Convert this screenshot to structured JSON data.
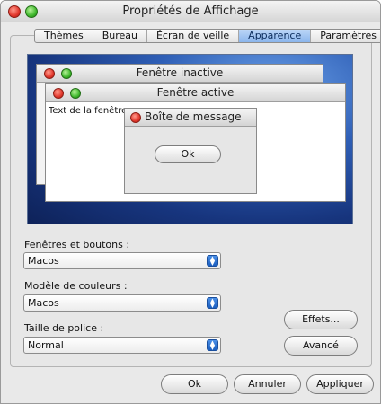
{
  "window": {
    "title": "Propriétés de Affichage"
  },
  "tabs": [
    {
      "label": "Thèmes"
    },
    {
      "label": "Bureau"
    },
    {
      "label": "Écran de veille"
    },
    {
      "label": "Apparence"
    },
    {
      "label": "Paramètres"
    }
  ],
  "active_tab": "Apparence",
  "preview": {
    "inactive_title": "Fenêtre inactive",
    "active_title": "Fenêtre active",
    "window_text": "Text de la fenêtre",
    "message_title": "Boîte de message",
    "message_ok": "Ok"
  },
  "fields": {
    "windows_buttons": {
      "label": "Fenêtres et boutons :",
      "value": "Macos"
    },
    "color_scheme": {
      "label": "Modèle de couleurs :",
      "value": "Macos"
    },
    "font_size": {
      "label": "Taille de police :",
      "value": "Normal"
    }
  },
  "side_buttons": {
    "effects": "Effets...",
    "advanced": "Avancé"
  },
  "footer": {
    "ok": "Ok",
    "cancel": "Annuler",
    "apply": "Appliquer"
  },
  "colors": {
    "tab_active": "#8ab5ec",
    "desktop": "#1d3f8c",
    "window_bg": "#e9e9e9"
  }
}
